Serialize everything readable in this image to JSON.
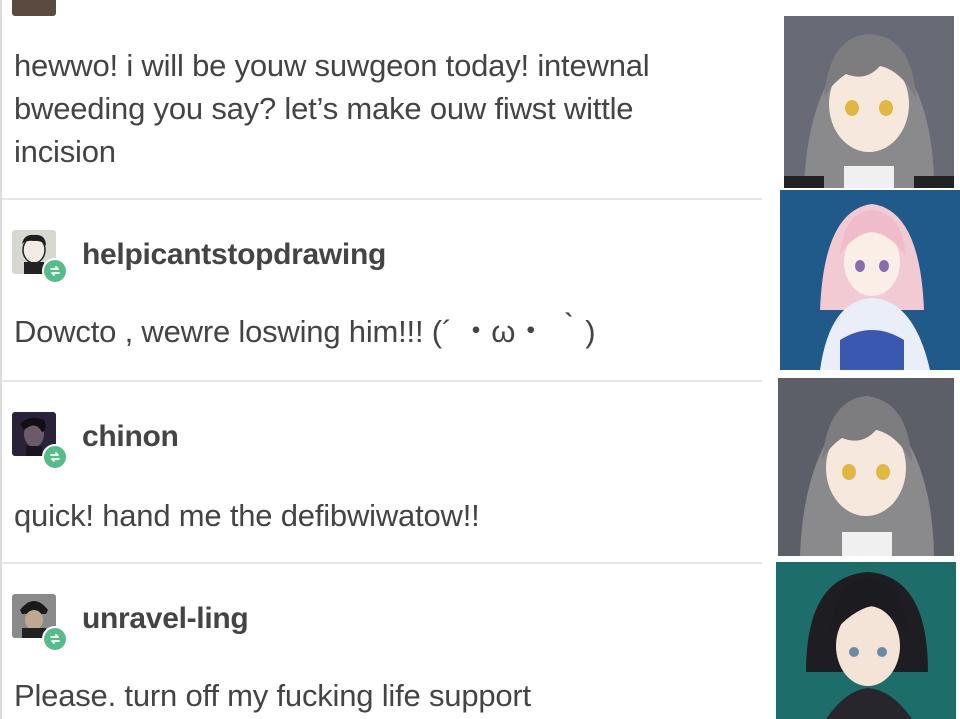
{
  "posts": [
    {
      "username": "",
      "lines": [
        "hewwo! i will be youw suwgeon today! intewnal",
        "bweeding you say? let’s make ouw fiwst wittle",
        "incision"
      ]
    },
    {
      "username": "helpicantstopdrawing",
      "lines": [
        "Dowcto , wewre loswing him!!! (´ ・ω・ ｀)"
      ]
    },
    {
      "username": "chinon",
      "lines": [
        "quick! hand me the defibwiwatow!!"
      ]
    },
    {
      "username": "unravel-ling",
      "lines": [
        "Please. turn off my fucking life support"
      ]
    }
  ],
  "icons": {
    "reblog": "reblog-icon",
    "avatar": "avatar"
  },
  "colors": {
    "reblog_badge": "#56bc8a",
    "text": "#444444",
    "divider": "#e6e6e6"
  },
  "portraits": [
    {
      "character": "gray-haired girl"
    },
    {
      "character": "pink-haired girl"
    },
    {
      "character": "gray-haired girl"
    },
    {
      "character": "dark-haired boy"
    }
  ]
}
